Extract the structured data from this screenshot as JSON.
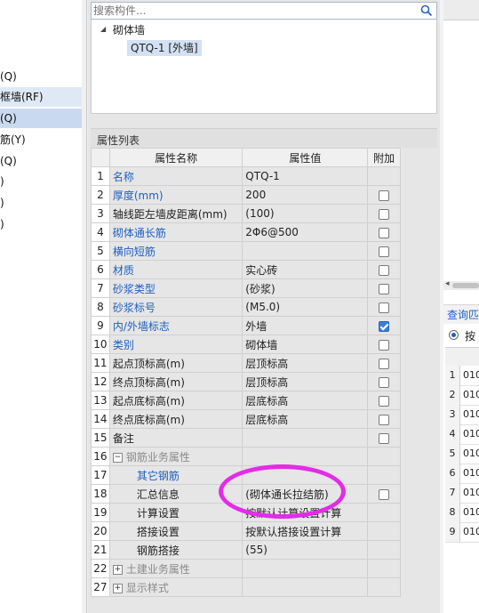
{
  "left_list": {
    "items": [
      {
        "label": "(Q)",
        "state": "normal"
      },
      {
        "label": "框墙(RF)",
        "state": "hover"
      },
      {
        "label": "(Q)",
        "state": "selected"
      },
      {
        "label": "筋(Y)",
        "state": "normal"
      },
      {
        "label": "(Q)",
        "state": "normal"
      },
      {
        "label": ")",
        "state": "normal"
      },
      {
        "label": ")",
        "state": "normal"
      },
      {
        "label": ")",
        "state": "normal"
      }
    ]
  },
  "search": {
    "placeholder": "搜索构件...",
    "icon": "search-icon"
  },
  "tree": {
    "root_label": "砌体墙",
    "child_label": "QTQ-1 [外墙]"
  },
  "properties": {
    "panel_title": "属性列表",
    "columns": [
      "属性名称",
      "属性值",
      "附加"
    ],
    "rows": [
      {
        "num": "1",
        "name": "名称",
        "value": "QTQ-1",
        "style": "blue",
        "checkbox": null
      },
      {
        "num": "2",
        "name": "厚度(mm)",
        "value": "200",
        "style": "blue",
        "checkbox": false
      },
      {
        "num": "3",
        "name": "轴线距左墙皮距离(mm)",
        "value": "(100)",
        "style": "black",
        "checkbox": false
      },
      {
        "num": "4",
        "name": "砌体通长筋",
        "value": "2Φ6@500",
        "style": "blue",
        "checkbox": false
      },
      {
        "num": "5",
        "name": "横向短筋",
        "value": "",
        "style": "blue",
        "checkbox": false
      },
      {
        "num": "6",
        "name": "材质",
        "value": "实心砖",
        "style": "blue",
        "checkbox": false
      },
      {
        "num": "7",
        "name": "砂浆类型",
        "value": "(砂浆)",
        "style": "blue",
        "checkbox": false
      },
      {
        "num": "8",
        "name": "砂浆标号",
        "value": "(M5.0)",
        "style": "blue",
        "checkbox": false
      },
      {
        "num": "9",
        "name": "内/外墙标志",
        "value": "外墙",
        "style": "blue",
        "checkbox": true
      },
      {
        "num": "10",
        "name": "类别",
        "value": "砌体墙",
        "style": "blue",
        "checkbox": false
      },
      {
        "num": "11",
        "name": "起点顶标高(m)",
        "value": "层顶标高",
        "style": "black",
        "checkbox": false
      },
      {
        "num": "12",
        "name": "终点顶标高(m)",
        "value": "层顶标高",
        "style": "black",
        "checkbox": false
      },
      {
        "num": "13",
        "name": "起点底标高(m)",
        "value": "层底标高",
        "style": "black",
        "checkbox": false
      },
      {
        "num": "14",
        "name": "终点底标高(m)",
        "value": "层底标高",
        "style": "black",
        "checkbox": false
      },
      {
        "num": "15",
        "name": "备注",
        "value": "",
        "style": "black",
        "checkbox": false
      },
      {
        "num": "16",
        "name": "钢筋业务属性",
        "value": "",
        "style": "gray",
        "checkbox": null,
        "expander": "−",
        "indent": 0
      },
      {
        "num": "17",
        "name": "其它钢筋",
        "value": "",
        "style": "blue",
        "checkbox": null,
        "indent": 1
      },
      {
        "num": "18",
        "name": "汇总信息",
        "value": "(砌体通长拉结筋)",
        "style": "black",
        "checkbox": false,
        "indent": 1
      },
      {
        "num": "19",
        "name": "计算设置",
        "value": "按默认计算设置计算",
        "style": "black",
        "checkbox": null,
        "indent": 1
      },
      {
        "num": "20",
        "name": "搭接设置",
        "value": "按默认搭接设置计算",
        "style": "black",
        "checkbox": null,
        "indent": 1
      },
      {
        "num": "21",
        "name": "钢筋搭接",
        "value": "(55)",
        "style": "black",
        "checkbox": null,
        "indent": 1
      },
      {
        "num": "22",
        "name": "土建业务属性",
        "value": "",
        "style": "gray",
        "checkbox": null,
        "expander": "+",
        "indent": 0
      },
      {
        "num": "27",
        "name": "显示样式",
        "value": "",
        "style": "gray",
        "checkbox": null,
        "expander": "+",
        "indent": 0
      }
    ]
  },
  "right_panel": {
    "query_tab": "查询匹",
    "radio_label": "按",
    "rows": [
      {
        "num": "1",
        "value": "010"
      },
      {
        "num": "2",
        "value": "010"
      },
      {
        "num": "3",
        "value": "010"
      },
      {
        "num": "4",
        "value": "010"
      },
      {
        "num": "5",
        "value": "010"
      },
      {
        "num": "6",
        "value": "010"
      },
      {
        "num": "7",
        "value": "010"
      },
      {
        "num": "8",
        "value": "010"
      },
      {
        "num": "9",
        "value": "010"
      }
    ]
  },
  "colors": {
    "accent": "#1f5fc0",
    "annotation": "#e22ce8",
    "selected": "#c9daf0"
  }
}
